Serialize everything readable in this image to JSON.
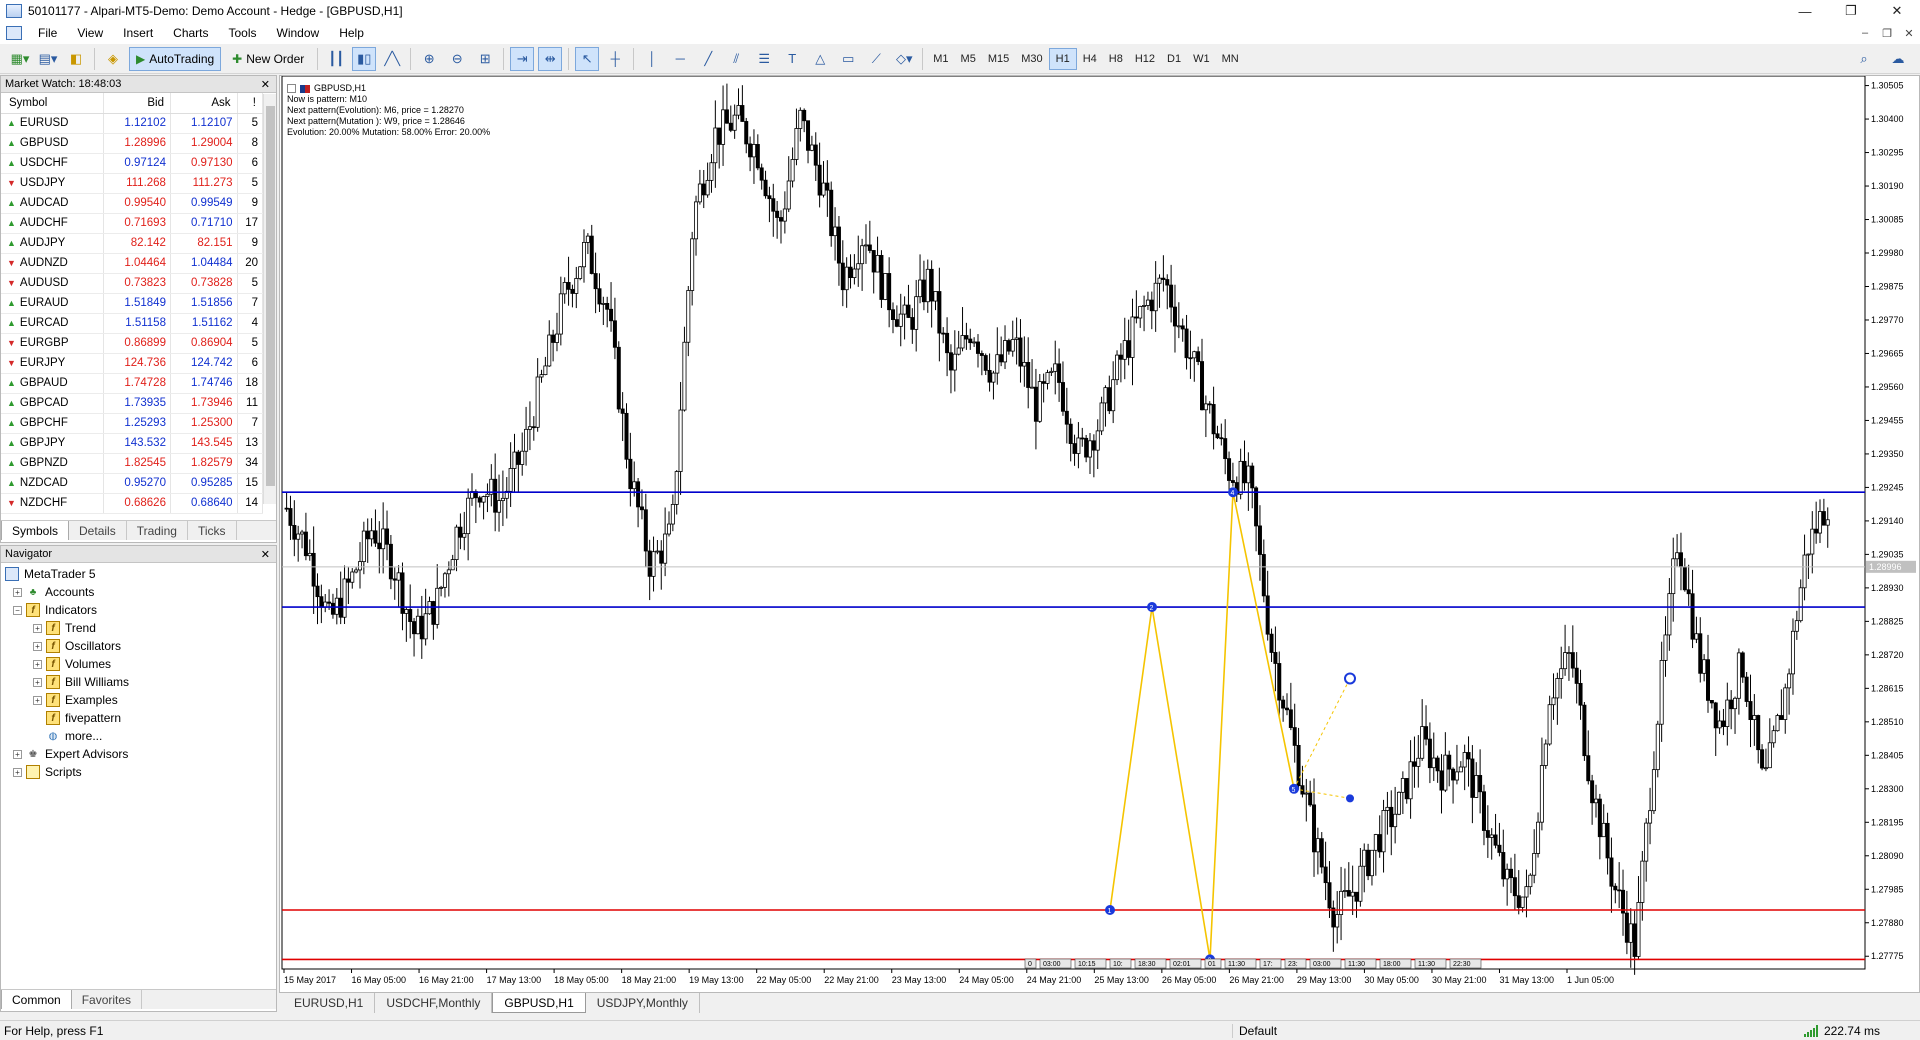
{
  "window": {
    "title": "50101177 - Alpari-MT5-Demo: Demo Account - Hedge - [GBPUSD,H1]",
    "minimize": "—",
    "maximize": "❐",
    "close": "✕"
  },
  "menu": {
    "items": [
      "File",
      "View",
      "Insert",
      "Charts",
      "Tools",
      "Window",
      "Help"
    ],
    "right_controls": [
      "‒",
      "❐",
      "✕"
    ]
  },
  "toolbar": {
    "autotrading_label": "AutoTrading",
    "new_order_label": "New Order",
    "timeframes": [
      "M1",
      "M5",
      "M15",
      "M30",
      "H1",
      "H4",
      "H8",
      "H12",
      "D1",
      "W1",
      "MN"
    ],
    "active_timeframe": "H1"
  },
  "market_watch": {
    "title": "Market Watch: 18:48:03",
    "close": "✕",
    "columns": [
      "Symbol",
      "Bid",
      "Ask",
      "!"
    ],
    "rows": [
      {
        "symbol": "EURUSD",
        "dir": "up",
        "bid": "1.12102",
        "ask": "1.12107",
        "spread": "5",
        "bid_color": "blue",
        "ask_color": "blue"
      },
      {
        "symbol": "GBPUSD",
        "dir": "up",
        "bid": "1.28996",
        "ask": "1.29004",
        "spread": "8",
        "bid_color": "red",
        "ask_color": "red"
      },
      {
        "symbol": "USDCHF",
        "dir": "up",
        "bid": "0.97124",
        "ask": "0.97130",
        "spread": "6",
        "bid_color": "blue",
        "ask_color": "red"
      },
      {
        "symbol": "USDJPY",
        "dir": "down",
        "bid": "111.268",
        "ask": "111.273",
        "spread": "5",
        "bid_color": "red",
        "ask_color": "red"
      },
      {
        "symbol": "AUDCAD",
        "dir": "up",
        "bid": "0.99540",
        "ask": "0.99549",
        "spread": "9",
        "bid_color": "red",
        "ask_color": "blue"
      },
      {
        "symbol": "AUDCHF",
        "dir": "up",
        "bid": "0.71693",
        "ask": "0.71710",
        "spread": "17",
        "bid_color": "red",
        "ask_color": "blue"
      },
      {
        "symbol": "AUDJPY",
        "dir": "up",
        "bid": "82.142",
        "ask": "82.151",
        "spread": "9",
        "bid_color": "red",
        "ask_color": "red"
      },
      {
        "symbol": "AUDNZD",
        "dir": "down",
        "bid": "1.04464",
        "ask": "1.04484",
        "spread": "20",
        "bid_color": "red",
        "ask_color": "blue"
      },
      {
        "symbol": "AUDUSD",
        "dir": "down",
        "bid": "0.73823",
        "ask": "0.73828",
        "spread": "5",
        "bid_color": "red",
        "ask_color": "red"
      },
      {
        "symbol": "EURAUD",
        "dir": "up",
        "bid": "1.51849",
        "ask": "1.51856",
        "spread": "7",
        "bid_color": "blue",
        "ask_color": "blue"
      },
      {
        "symbol": "EURCAD",
        "dir": "up",
        "bid": "1.51158",
        "ask": "1.51162",
        "spread": "4",
        "bid_color": "blue",
        "ask_color": "blue"
      },
      {
        "symbol": "EURGBP",
        "dir": "down",
        "bid": "0.86899",
        "ask": "0.86904",
        "spread": "5",
        "bid_color": "red",
        "ask_color": "red"
      },
      {
        "symbol": "EURJPY",
        "dir": "down",
        "bid": "124.736",
        "ask": "124.742",
        "spread": "6",
        "bid_color": "red",
        "ask_color": "blue"
      },
      {
        "symbol": "GBPAUD",
        "dir": "up",
        "bid": "1.74728",
        "ask": "1.74746",
        "spread": "18",
        "bid_color": "red",
        "ask_color": "blue"
      },
      {
        "symbol": "GBPCAD",
        "dir": "up",
        "bid": "1.73935",
        "ask": "1.73946",
        "spread": "11",
        "bid_color": "blue",
        "ask_color": "red"
      },
      {
        "symbol": "GBPCHF",
        "dir": "up",
        "bid": "1.25293",
        "ask": "1.25300",
        "spread": "7",
        "bid_color": "blue",
        "ask_color": "red"
      },
      {
        "symbol": "GBPJPY",
        "dir": "up",
        "bid": "143.532",
        "ask": "143.545",
        "spread": "13",
        "bid_color": "blue",
        "ask_color": "red"
      },
      {
        "symbol": "GBPNZD",
        "dir": "up",
        "bid": "1.82545",
        "ask": "1.82579",
        "spread": "34",
        "bid_color": "red",
        "ask_color": "red"
      },
      {
        "symbol": "NZDCAD",
        "dir": "up",
        "bid": "0.95270",
        "ask": "0.95285",
        "spread": "15",
        "bid_color": "blue",
        "ask_color": "blue"
      },
      {
        "symbol": "NZDCHF",
        "dir": "down",
        "bid": "0.68626",
        "ask": "0.68640",
        "spread": "14",
        "bid_color": "red",
        "ask_color": "blue"
      }
    ],
    "tabs": [
      "Symbols",
      "Details",
      "Trading",
      "Ticks"
    ],
    "active_tab": "Symbols"
  },
  "navigator": {
    "title": "Navigator",
    "close": "✕",
    "root": "MetaTrader 5",
    "accounts": "Accounts",
    "indicators": "Indicators",
    "indicator_children": [
      "Trend",
      "Oscillators",
      "Volumes",
      "Bill Williams",
      "Examples"
    ],
    "custom_indicator": "fivepattern",
    "more": "more...",
    "expert_advisors": "Expert Advisors",
    "scripts": "Scripts",
    "tabs": [
      "Common",
      "Favorites"
    ],
    "active_tab": "Common"
  },
  "chart": {
    "symbol_label": "GBPUSD,H1",
    "info_lines": [
      "Now is pattern: M10",
      "Next pattern(Evolution): M6, price = 1.28270",
      "Next pattern(Mutation ): W9, price = 1.28646",
      "Evolution: 20.00% Mutation: 58.00% Error: 20.00%"
    ],
    "current_price_label": "1.28996",
    "tabs": [
      "EURUSD,H1",
      "USDCHF,Monthly",
      "GBPUSD,H1",
      "USDJPY,Monthly"
    ],
    "active_tab": "GBPUSD,H1",
    "colors": {
      "resistance": "#0000cc",
      "support": "#e00000",
      "pattern": "#f5c400",
      "pattern_points": "#1a3adb"
    }
  },
  "chart_data": {
    "type": "candlestick",
    "symbol": "GBPUSD",
    "timeframe": "H1",
    "y_ticks": [
      "1.30505",
      "1.30400",
      "1.30295",
      "1.30190",
      "1.30085",
      "1.29980",
      "1.29875",
      "1.29770",
      "1.29665",
      "1.29560",
      "1.29455",
      "1.29350",
      "1.29245",
      "1.29140",
      "1.29035",
      "1.28930",
      "1.28825",
      "1.28720",
      "1.28615",
      "1.28510",
      "1.28405",
      "1.28300",
      "1.28195",
      "1.28090",
      "1.27985",
      "1.27880",
      "1.27775"
    ],
    "ylim": [
      1.27735,
      1.30535
    ],
    "x_ticks": [
      "15 May 2017",
      "16 May 05:00",
      "16 May 21:00",
      "17 May 13:00",
      "18 May 05:00",
      "18 May 21:00",
      "19 May 13:00",
      "22 May 05:00",
      "22 May 21:00",
      "23 May 13:00",
      "24 May 05:00",
      "24 May 21:00",
      "25 May 13:00",
      "26 May 05:00",
      "26 May 21:00",
      "29 May 13:00",
      "30 May 05:00",
      "30 May 21:00",
      "31 May 13:00",
      "1 Jun 05:00"
    ],
    "close_path": [
      1.2918,
      1.2905,
      1.2882,
      1.2895,
      1.2912,
      1.29,
      1.2878,
      1.2888,
      1.2912,
      1.2925,
      1.292,
      1.2935,
      1.296,
      1.2985,
      1.3,
      1.298,
      1.293,
      1.29,
      1.291,
      1.301,
      1.3035,
      1.304,
      1.303,
      1.3005,
      1.304,
      1.302,
      1.299,
      1.3005,
      1.2985,
      1.2975,
      1.299,
      1.296,
      1.2975,
      1.296,
      1.297,
      1.295,
      1.296,
      1.2935,
      1.2945,
      1.2965,
      1.298,
      1.299,
      1.297,
      1.295,
      1.293,
      1.2925,
      1.2875,
      1.2845,
      1.2815,
      1.279,
      1.28,
      1.2815,
      1.2825,
      1.2845,
      1.2835,
      1.284,
      1.282,
      1.28,
      1.2795,
      1.286,
      1.2872,
      1.283,
      1.28,
      1.278,
      1.285,
      1.291,
      1.287,
      1.285,
      1.287,
      1.283,
      1.286,
      1.2905,
      1.292
    ],
    "resistance_lines": [
      1.2923,
      1.2887
    ],
    "support_lines": [
      1.2792,
      1.27765
    ],
    "pattern_points": [
      {
        "label": "1",
        "price": 1.2792
      },
      {
        "label": "2",
        "price": 1.2887
      },
      {
        "label": "3",
        "price": 1.27765
      },
      {
        "label": "4",
        "price": 1.2923
      },
      {
        "label": "5",
        "price": 1.283
      }
    ],
    "projections": [
      {
        "name": "Evolution",
        "price": 1.2827
      },
      {
        "name": "Mutation",
        "price": 1.28646
      }
    ],
    "time_labels": [
      "0",
      "03:00",
      "10:15",
      "10:",
      "18:30",
      "02:01",
      "01",
      "11:30",
      "17:",
      "23:",
      "03:00",
      "11:30",
      "18:00",
      "11:30",
      "22:30"
    ]
  },
  "status": {
    "help": "For Help, press F1",
    "profile": "Default",
    "ping": "222.74 ms"
  }
}
